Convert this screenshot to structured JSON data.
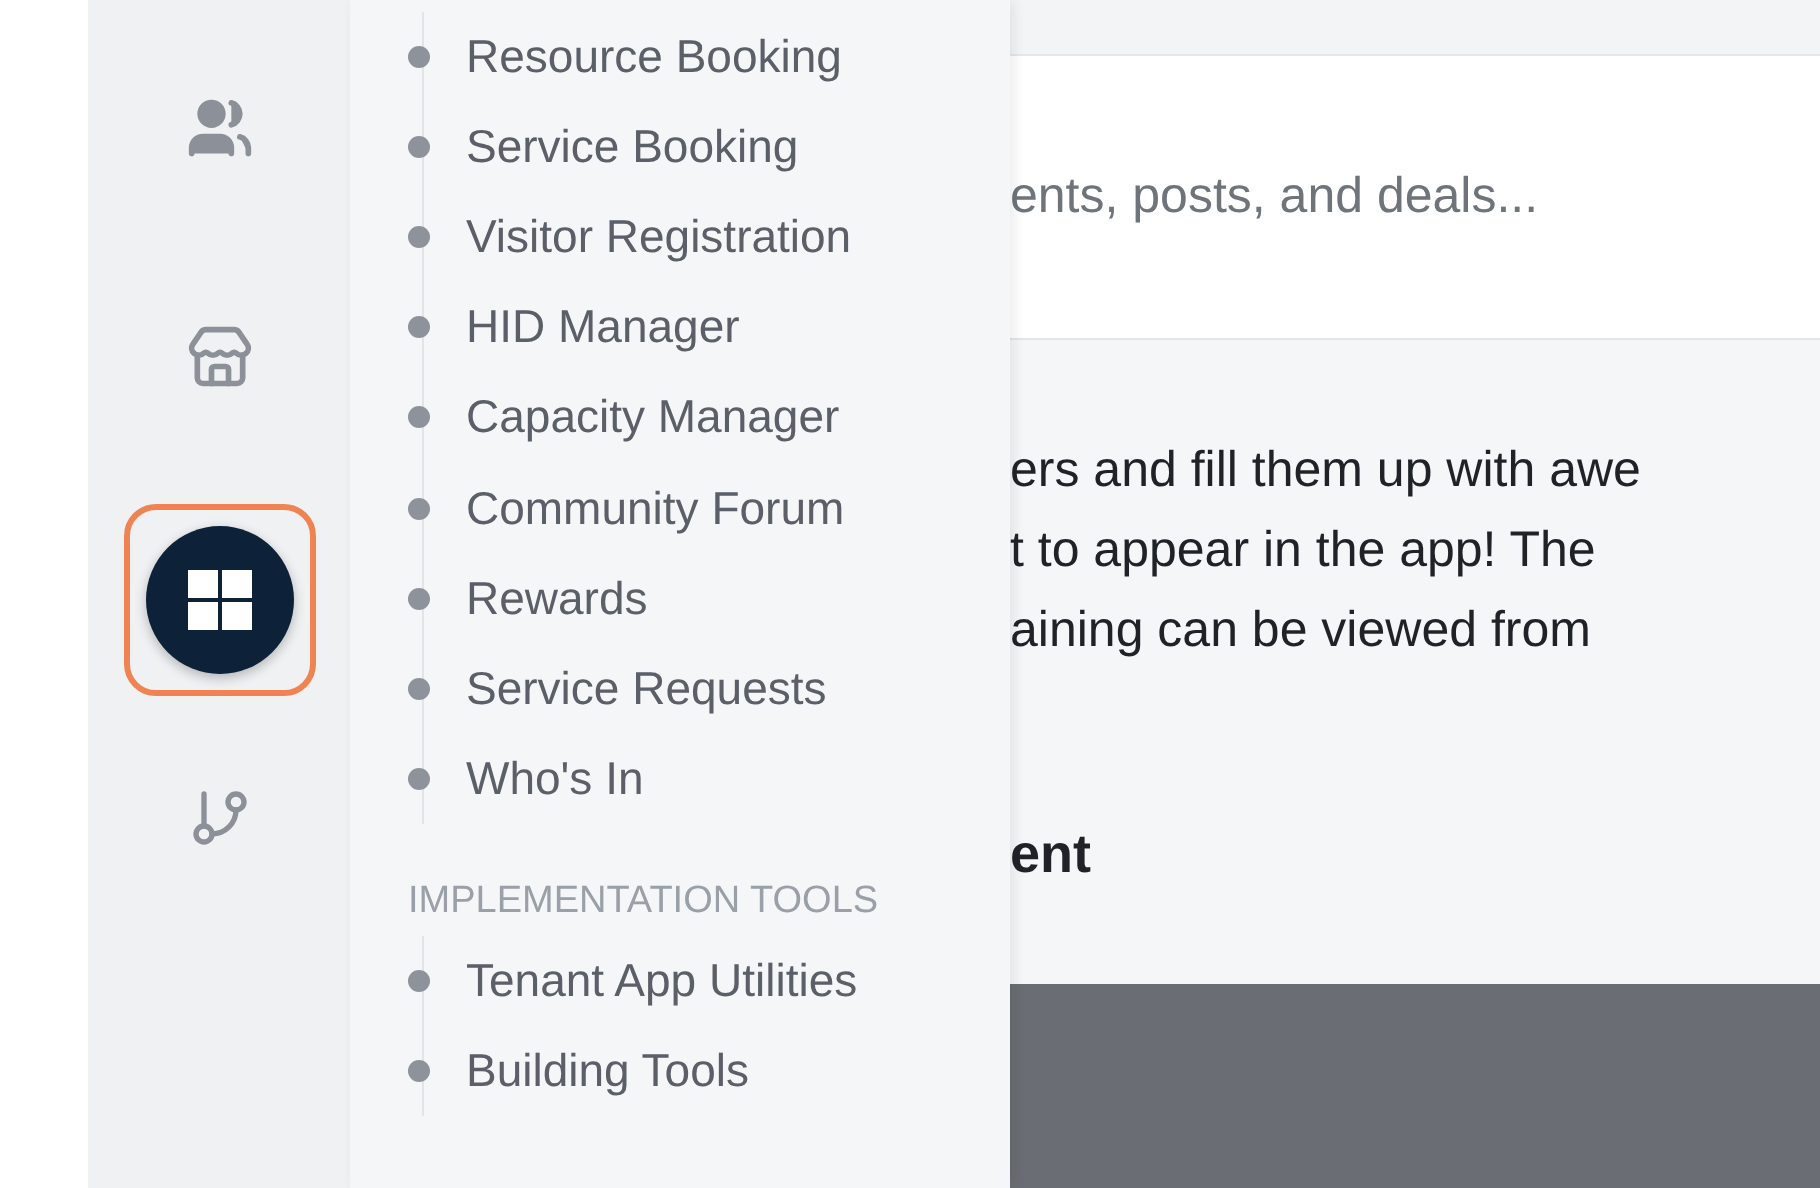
{
  "rail": [
    {
      "kind": "users",
      "selected": false
    },
    {
      "kind": "store",
      "selected": false
    },
    {
      "kind": "grid",
      "selected": true
    },
    {
      "kind": "branch",
      "selected": false
    }
  ],
  "menu": {
    "items": [
      "Resource Booking",
      "Service Booking",
      "Visitor Registration",
      "HID Manager",
      "Capacity Manager",
      "Community Forum",
      "Rewards",
      "Service Requests",
      "Who's In"
    ],
    "sections": [
      {
        "title": "IMPLEMENTATION TOOLS",
        "items": [
          "Tenant App Utilities",
          "Building Tools"
        ]
      }
    ]
  },
  "main": {
    "search": {
      "placeholder": "ents, posts, and deals..."
    },
    "intro": [
      "ers and fill them up with awe",
      "t to appear in the app! The",
      "aining can be viewed from"
    ],
    "heading": "ent"
  }
}
